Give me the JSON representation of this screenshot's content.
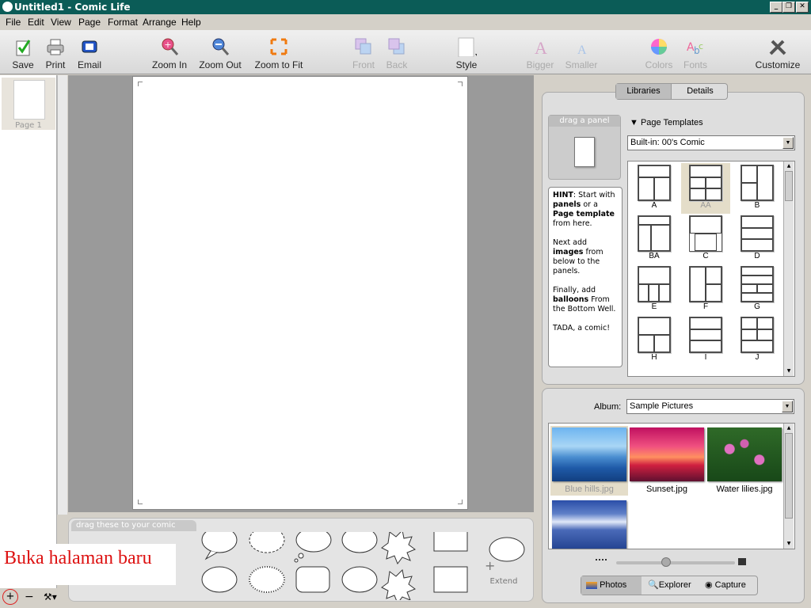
{
  "window": {
    "title": "Untitled1 - Comic Life"
  },
  "menu": [
    "File",
    "Edit",
    "View",
    "Page",
    "Format",
    "Arrange",
    "Help"
  ],
  "toolbar": {
    "save": "Save",
    "print": "Print",
    "email": "Email",
    "zoom_in": "Zoom In",
    "zoom_out": "Zoom Out",
    "zoom_fit": "Zoom to Fit",
    "front": "Front",
    "back": "Back",
    "style": "Style",
    "bigger": "Bigger",
    "smaller": "Smaller",
    "colors": "Colors",
    "fonts": "Fonts",
    "customize": "Customize"
  },
  "pages": {
    "page1_label": "Page 1"
  },
  "bottom_well": {
    "header": "drag these to your comic",
    "extend": "Extend"
  },
  "overlay_text": "Buka halaman baru",
  "tabs": {
    "libraries": "Libraries",
    "details": "Details"
  },
  "drag_panel": {
    "header": "drag a panel"
  },
  "hint": {
    "p1a": "HINT",
    "p1b": ": Start with ",
    "p1c": "panels",
    "p1d": " or a ",
    "p1e": "Page template",
    "p1f": " from here.",
    "p2a": "Next add ",
    "p2b": "images",
    "p2c": " from below to the panels.",
    "p3a": "Finally, add ",
    "p3b": "balloons",
    "p3c": " From the Bottom Well.",
    "p4": "TADA, a comic!"
  },
  "page_templates": {
    "header": "Page Templates",
    "selected": "Built-in: 00's Comic",
    "items": [
      "A",
      "AA",
      "B",
      "BA",
      "C",
      "D",
      "E",
      "F",
      "G",
      "H",
      "I",
      "J"
    ],
    "selected_item": "AA"
  },
  "album": {
    "label": "Album:",
    "selected": "Sample Pictures"
  },
  "photos": [
    "Blue hills.jpg",
    "Sunset.jpg",
    "Water lilies.jpg"
  ],
  "photo_tabs": {
    "photos": "Photos",
    "explorer": "Explorer",
    "capture": "Capture"
  },
  "colors": {
    "titlebar": "#0b5c57",
    "hint_red": "#d11"
  }
}
